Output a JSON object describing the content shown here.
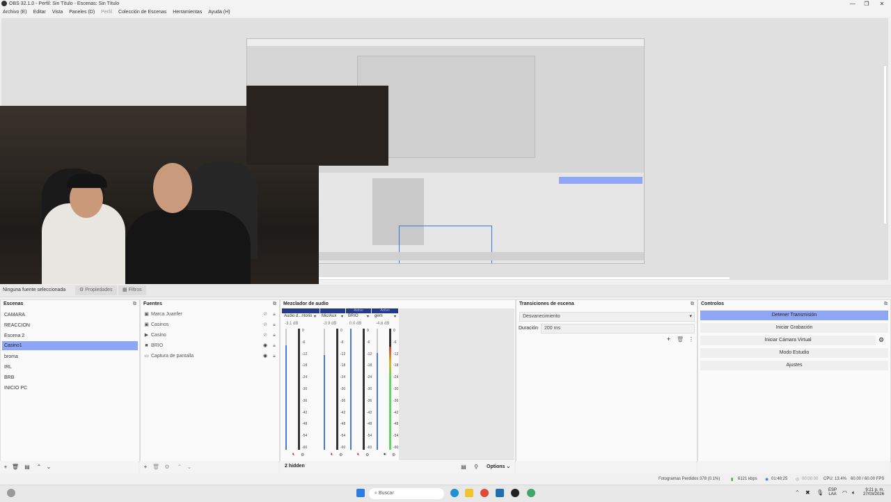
{
  "window": {
    "title": "OBS 32.1.0 - Perfil: Sin Título - Escenas: Sin Título",
    "controls": [
      "—",
      "❐",
      "✕"
    ]
  },
  "menu": [
    "Archivo (E)",
    "Editar",
    "Vista",
    "Paneles (D)",
    "Perfil",
    "Colección de Escenas",
    "Herramientas",
    "Ayuda (H)"
  ],
  "source_toolbar": {
    "selection": "Ninguna fuente seleccionada",
    "properties": "Propiedades",
    "filters": "Filtros"
  },
  "scenes": {
    "title": "Escenas",
    "items": [
      "CAMARA",
      "REACCION",
      "Escena 2",
      "Casino1",
      "broma",
      "IRL",
      "BRB",
      "INICIO PC"
    ],
    "selected_index": 3
  },
  "sources": {
    "title": "Fuentes",
    "items": [
      {
        "name": "Marca Juanfer",
        "icon": "image-icon",
        "visible": false
      },
      {
        "name": "Casinos",
        "icon": "image-icon",
        "visible": false
      },
      {
        "name": "Casino",
        "icon": "play-icon",
        "visible": false
      },
      {
        "name": "BRIO",
        "icon": "camera-icon",
        "visible": true
      },
      {
        "name": "Captura de pantalla",
        "icon": "monitor-icon",
        "visible": true
      }
    ]
  },
  "mixer": {
    "title": "Mezclador de audio",
    "live_label": "Activo",
    "channels": [
      {
        "name": "Audio d...ntorio",
        "db": "-3.1 dB",
        "volume": 0.86,
        "level": 0.0
      },
      {
        "name": "Mic/Aux",
        "db": "-3.9 dB",
        "volume": 0.78,
        "level": 0.0
      },
      {
        "name": "BRIO",
        "db": "0.0 dB",
        "volume": 1.0,
        "level": 0.0
      },
      {
        "name": "gem",
        "db": "-4.6 dB",
        "volume": 0.8,
        "level": 0.85
      }
    ],
    "scale": [
      "0",
      "-6",
      "-12",
      "-18",
      "-24",
      "-30",
      "-36",
      "-42",
      "-48",
      "-54",
      "-60"
    ],
    "hidden": "2 hidden",
    "options": "Options"
  },
  "transitions": {
    "title": "Transiciones de escena",
    "type": "Desvanecimiento",
    "duration_label": "Duración",
    "duration_value": "200 ms"
  },
  "controls": {
    "title": "Controlos",
    "buttons": [
      "Detener Transmisión",
      "Iniciar Grabación",
      "Iniciar Cámara Virtual",
      "Modo Estudio",
      "Ajustes"
    ]
  },
  "status": {
    "dropped": "Fotogramas Perdidos 378 (0.1%)",
    "bitrate": "6121 kbps",
    "live_time": "01:48:25",
    "rec_time": "00:00:00",
    "cpu": "CPU: 13.4%",
    "fps": "60.00 / 60.00 FPS"
  },
  "taskbar": {
    "search": "Buscar",
    "lang": "ESP",
    "lang2": "LAA",
    "time": "9:21 p. m.",
    "date": "27/03/2026"
  },
  "colors": {
    "accent": "#8fa6f5",
    "mixer_header": "#233a8a",
    "meter_green": "#5cd85a",
    "meter_red": "#d23a3a"
  }
}
